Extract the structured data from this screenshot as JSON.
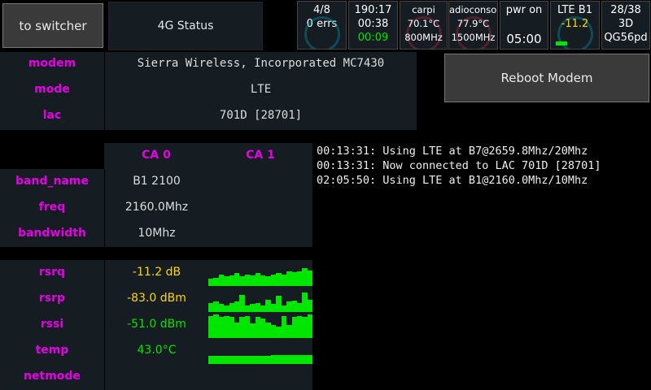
{
  "top": {
    "switcher_label": "to switcher",
    "tab_label": "4G Status",
    "tiles": [
      {
        "l1": "4/8",
        "l2": "0 errs",
        "l3": ""
      },
      {
        "l1": "190:17",
        "l2": "00:38",
        "l3": "00:09"
      },
      {
        "l1": "carpi",
        "l2": "70.1°C",
        "l3": "800MHz"
      },
      {
        "l1": "adioconsol",
        "l2": "77.9°C",
        "l3": "1500MHz"
      },
      {
        "l1": "pwr on",
        "l2": "",
        "l3": "05:00"
      },
      {
        "l1": "LTE B1",
        "l2": "-11.2",
        "l3": ""
      },
      {
        "l1": "28/38",
        "l2": "3D",
        "l3": "QG56pd"
      }
    ]
  },
  "info": {
    "rows": [
      {
        "label": "modem",
        "value": "Sierra Wireless, Incorporated MC7430"
      },
      {
        "label": "mode",
        "value": "LTE"
      },
      {
        "label": "lac",
        "value": "701D [28701]"
      }
    ],
    "reboot_label": "Reboot Modem"
  },
  "ca": {
    "headers": [
      "CA 0",
      "CA 1"
    ],
    "rows": [
      {
        "label": "band_name",
        "value": "B1 2100"
      },
      {
        "label": "freq",
        "value": "2160.0Mhz"
      },
      {
        "label": "bandwidth",
        "value": "10Mhz"
      }
    ]
  },
  "signal": {
    "rows": [
      {
        "label": "rsrq",
        "value": "-11.2 dB",
        "color": "#ffd700",
        "spark": [
          0.35,
          0.4,
          0.55,
          0.45,
          0.5,
          0.6,
          0.45,
          0.55,
          0.5,
          0.6,
          0.5,
          0.45,
          0.55,
          0.6,
          0.55,
          0.7,
          0.65,
          0.7,
          0.85,
          0.75
        ]
      },
      {
        "label": "rsrp",
        "value": "-83.0 dBm",
        "color": "#ffd700",
        "spark": [
          0.4,
          0.45,
          0.35,
          0.3,
          0.4,
          0.45,
          0.75,
          0.3,
          0.35,
          0.4,
          0.3,
          0.55,
          0.35,
          0.7,
          0.3,
          0.45,
          0.5,
          0.4,
          0.85,
          0.55
        ]
      },
      {
        "label": "rssi",
        "value": "-51.0 dBm",
        "color": "#00e600",
        "spark": [
          0.85,
          0.9,
          0.8,
          0.85,
          0.8,
          0.6,
          0.8,
          0.85,
          0.55,
          0.8,
          0.75,
          0.6,
          0.5,
          0.45,
          0.85,
          0.5,
          0.8,
          0.85,
          0.8,
          0.9
        ]
      },
      {
        "label": "temp",
        "value": "43.0°C",
        "color": "#00e600",
        "spark": [
          0.4,
          0.4,
          0.4,
          0.4,
          0.4,
          0.4,
          0.4,
          0.4,
          0.4,
          0.4,
          0.4,
          0.4,
          0.45,
          0.45,
          0.45,
          0.45,
          0.45,
          0.45,
          0.45,
          0.45
        ]
      },
      {
        "label": "netmode",
        "value": "",
        "color": "#00e600",
        "spark": []
      }
    ]
  },
  "log": {
    "lines": [
      "00:13:31: Using LTE at B7@2659.8Mhz/20Mhz",
      "00:13:31: Now connected to LAC 701D [28701]",
      "02:05:50: Using LTE at B1@2160.0Mhz/10Mhz"
    ]
  }
}
